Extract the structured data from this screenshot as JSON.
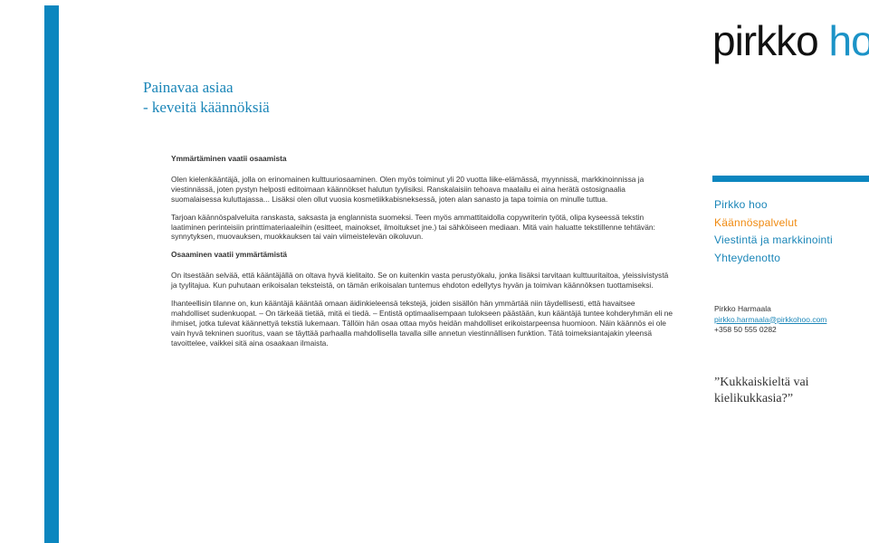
{
  "brand": {
    "part1": "pirkko",
    "part2": "hoo"
  },
  "headline": {
    "line1": "Painavaa asiaa",
    "line2": "- keveitä käännöksiä"
  },
  "article": {
    "heading1": "Ymmärtäminen vaatii osaamista",
    "para1": "Olen kielenkääntäjä, jolla on erinomainen kulttuuriosaaminen. Olen myös toiminut yli 20 vuotta liike-elämässä, myynnissä, markkinoinnissa ja viestinnässä, joten pystyn helposti editoimaan käännökset halutun tyylisiksi. Ranskalaisiin tehoava maalailu ei aina herätä ostosignaalia suomalaisessa kuluttajassa... Lisäksi olen ollut vuosia kosmetiikkabisneksessä, joten alan sanasto ja tapa toimia on minulle tuttua.",
    "para2": "Tarjoan käännöspalveluita ranskasta, saksasta ja englannista suomeksi. Teen myös ammattitaidolla copywriterin työtä, olipa kyseessä tekstin laatiminen perinteisiin printtimateriaaleihin (esitteet, mainokset, ilmoitukset jne.) tai sähköiseen mediaan. Mitä vain haluatte tekstillenne tehtävän: synnytyksen, muovauksen, muokkauksen tai vain viimeistelevän oikoluvun.",
    "heading2": "Osaaminen vaatii ymmärtämistä",
    "para3": "On itsestään selvää, että kääntäjällä on oltava hyvä kielitaito. Se on kuitenkin vasta perustyökalu, jonka lisäksi tarvitaan kulttuuritaitoa, yleissivistystä ja tyylitajua. Kun puhutaan erikoisalan teksteistä, on tämän erikoisalan tuntemus ehdoton edellytys hyvän ja toimivan käännöksen tuottamiseksi.",
    "para4": "Ihanteellisin tilanne on, kun kääntäjä kääntää omaan äidinkieleensä tekstejä, joiden sisällön hän ymmärtää niin täydellisesti, että havaitsee mahdolliset sudenkuopat. – On tärkeää tietää, mitä ei tiedä. – Entistä optimaalisempaan tulokseen päästään, kun kääntäjä tuntee kohderyhmän eli ne ihmiset, jotka tulevat käännettyä tekstiä lukemaan. Tällöin hän osaa ottaa myös heidän mahdolliset erikoistarpeensa huomioon. Näin käännös ei ole vain hyvä tekninen suoritus, vaan se täyttää parhaalla mahdollisella tavalla sille annetun viestinnällisen funktion. Tätä toimeksiantajakin yleensä tavoittelee, vaikkei sitä aina osaakaan ilmaista."
  },
  "nav": {
    "items": [
      {
        "label": "Pirkko hoo"
      },
      {
        "label": "Käännöspalvelut"
      },
      {
        "label": "Viestintä ja markkinointi"
      },
      {
        "label": "Yhteydenotto"
      }
    ]
  },
  "contact": {
    "name": "Pirkko Harmaala",
    "email": "pirkko.harmaala@pirkkohoo.com",
    "phone": "+358 50 555 0282"
  },
  "quote": "”Kukkaiskieltä vai kielikukkasia?”",
  "colors": {
    "accent_blue": "#0b86bf",
    "active_orange": "#f08a10"
  }
}
